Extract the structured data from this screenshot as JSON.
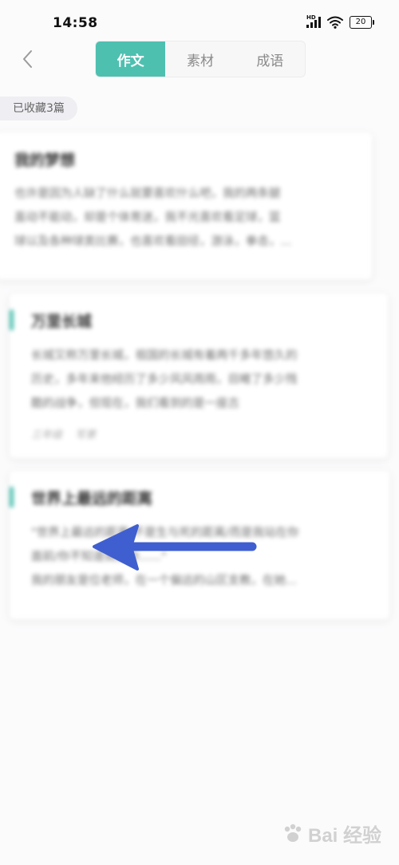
{
  "status_bar": {
    "time": "14:58",
    "network_label": "HD",
    "battery_level": "20",
    "icons": [
      "signal-icon",
      "wifi-icon",
      "battery-icon"
    ]
  },
  "header": {
    "back_icon": "chevron-left-icon",
    "tabs": [
      {
        "label": "作文",
        "active": true
      },
      {
        "label": "素材",
        "active": false
      },
      {
        "label": "成语",
        "active": false
      }
    ]
  },
  "collection": {
    "count_label": "已收藏3篇"
  },
  "cards": [
    {
      "title": "我的梦想",
      "lines": [
        "也许是因为人缺了什么就要喜欢什么吧，我的两条腿",
        "虽动不能动，却是个体育迷，我不光喜欢看足球，篮",
        "球以及各种球类比赛，也喜欢看田径，游泳，拳击，..."
      ],
      "tags": []
    },
    {
      "title": "万里长城",
      "lines": [
        "长城又称万里长城，祖国的长城有着两千多年悠久的",
        "历史，多年来他经历了多少风风雨雨，目睹了多少残",
        "酷的战争，但现在，我们看到的是一座古"
      ],
      "tags": [
        "三年级",
        "写景"
      ]
    },
    {
      "title": "世界上最远的距离",
      "lines": [
        "\"世界上最远的距离/不是生与死的距离/而是我站在你",
        "面前/你不知道我爱你......\"",
        "我的朋友是位老师，在一个偏远的山区支教，在她..."
      ],
      "tags": []
    }
  ],
  "overlay": {
    "arrow_color": "#3f5fd0"
  },
  "watermark": {
    "text": "Bai  经验"
  },
  "colors": {
    "accent": "#4ec0b0",
    "background": "#fbfbfc"
  }
}
